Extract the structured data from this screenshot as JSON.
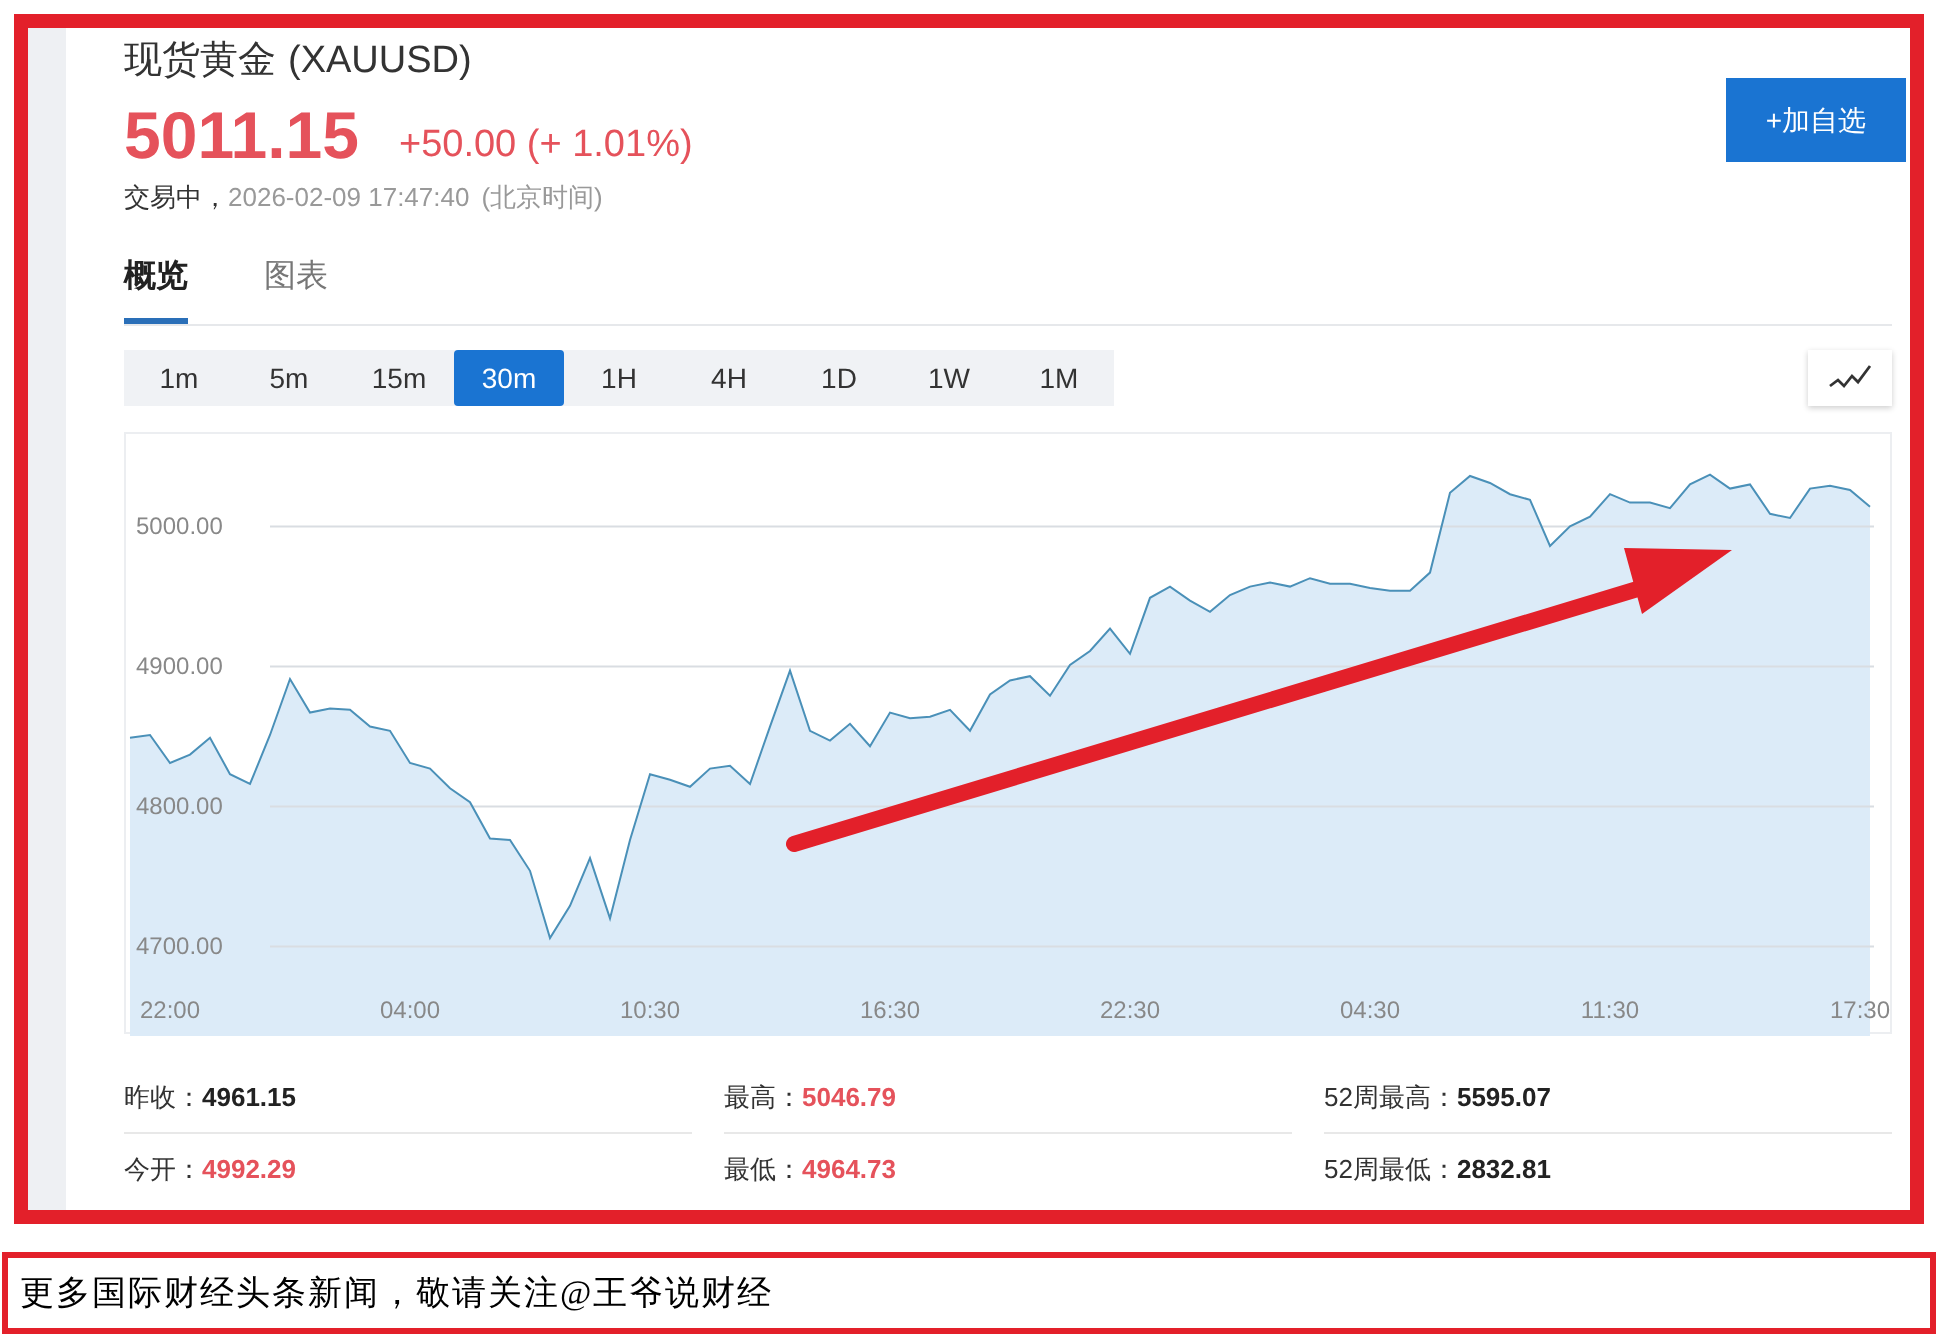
{
  "header": {
    "name": "现货黄金",
    "symbol": "(XAUUSD)",
    "price": "5011.15",
    "change": "+50.00 (+ 1.01%)",
    "status": "交易中，",
    "timestamp": "2026-02-09 17:47:40",
    "timezone": "(北京时间)",
    "watch_button": "+加自选"
  },
  "tabs": [
    {
      "label": "概览",
      "selected": true
    },
    {
      "label": "图表",
      "selected": false
    }
  ],
  "intervals": [
    {
      "label": "1m",
      "selected": false
    },
    {
      "label": "5m",
      "selected": false
    },
    {
      "label": "15m",
      "selected": false
    },
    {
      "label": "30m",
      "selected": true
    },
    {
      "label": "1H",
      "selected": false
    },
    {
      "label": "4H",
      "selected": false
    },
    {
      "label": "1D",
      "selected": false
    },
    {
      "label": "1W",
      "selected": false
    },
    {
      "label": "1M",
      "selected": false
    }
  ],
  "chart": {
    "chart_data": {
      "type": "area",
      "categories": [
        null,
        null,
        "22:00",
        null,
        null,
        null,
        null,
        null,
        null,
        null,
        null,
        null,
        null,
        null,
        "04:00",
        null,
        null,
        null,
        null,
        null,
        null,
        null,
        null,
        null,
        null,
        null,
        "10:30",
        null,
        null,
        null,
        null,
        null,
        null,
        null,
        null,
        null,
        null,
        null,
        "16:30",
        null,
        null,
        null,
        null,
        null,
        null,
        null,
        null,
        null,
        null,
        null,
        "22:30",
        null,
        null,
        null,
        null,
        null,
        null,
        null,
        null,
        null,
        null,
        null,
        "04:30",
        null,
        null,
        null,
        null,
        null,
        null,
        null,
        null,
        null,
        null,
        null,
        "11:30",
        null,
        null,
        null,
        null,
        null,
        null,
        null,
        null,
        null,
        null,
        null,
        "17:30",
        null
      ],
      "series": [
        {
          "color": "#4a90b8",
          "values": [
            4849,
            4851,
            4831,
            4837,
            4849,
            4823,
            4816,
            4851,
            4891,
            4867,
            4870,
            4869,
            4857,
            4854,
            4831,
            4827,
            4813,
            4803,
            4777,
            4776,
            4754,
            4706,
            4729,
            4763,
            4720,
            4776,
            4823,
            4819,
            4814,
            4827,
            4829,
            4816,
            4857,
            4897,
            4854,
            4847,
            4859,
            4843,
            4867,
            4863,
            4864,
            4869,
            4854,
            4880,
            4890,
            4893,
            4879,
            4901,
            4911,
            4927,
            4909,
            4949,
            4957,
            4947,
            4939,
            4951,
            4957,
            4960,
            4957,
            4963,
            4959,
            4959,
            4956,
            4954,
            4954,
            4967,
            5024,
            5036,
            5031,
            5023,
            5019,
            4986,
            5000,
            5007,
            5023,
            5017,
            5017,
            5013,
            5030,
            5037,
            5027,
            5030,
            5009,
            5006,
            5027,
            5029,
            5026,
            5014
          ]
        }
      ],
      "ylim": [
        4636,
        5066
      ],
      "grid": true,
      "yticks": [
        {
          "value": 4700,
          "label": "4700.00"
        },
        {
          "value": 4800,
          "label": "4800.00"
        },
        {
          "value": 4900,
          "label": "4900.00"
        },
        {
          "value": 5000,
          "label": "5000.00"
        }
      ]
    }
  },
  "stats": [
    {
      "label": "昨收：",
      "value": "4961.15",
      "color": "#222222"
    },
    {
      "label": "最高：",
      "value": "5046.79",
      "color": "#e5525b"
    },
    {
      "label": "52周最高：",
      "value": "5595.07",
      "color": "#222222"
    },
    {
      "label": "今开：",
      "value": "4992.29",
      "color": "#e5525b"
    },
    {
      "label": "最低：",
      "value": "4964.73",
      "color": "#e5525b"
    },
    {
      "label": "52周最低：",
      "value": "2832.81",
      "color": "#222222"
    }
  ],
  "caption": "更多国际财经头条新闻，敬请关注@王爷说财经"
}
